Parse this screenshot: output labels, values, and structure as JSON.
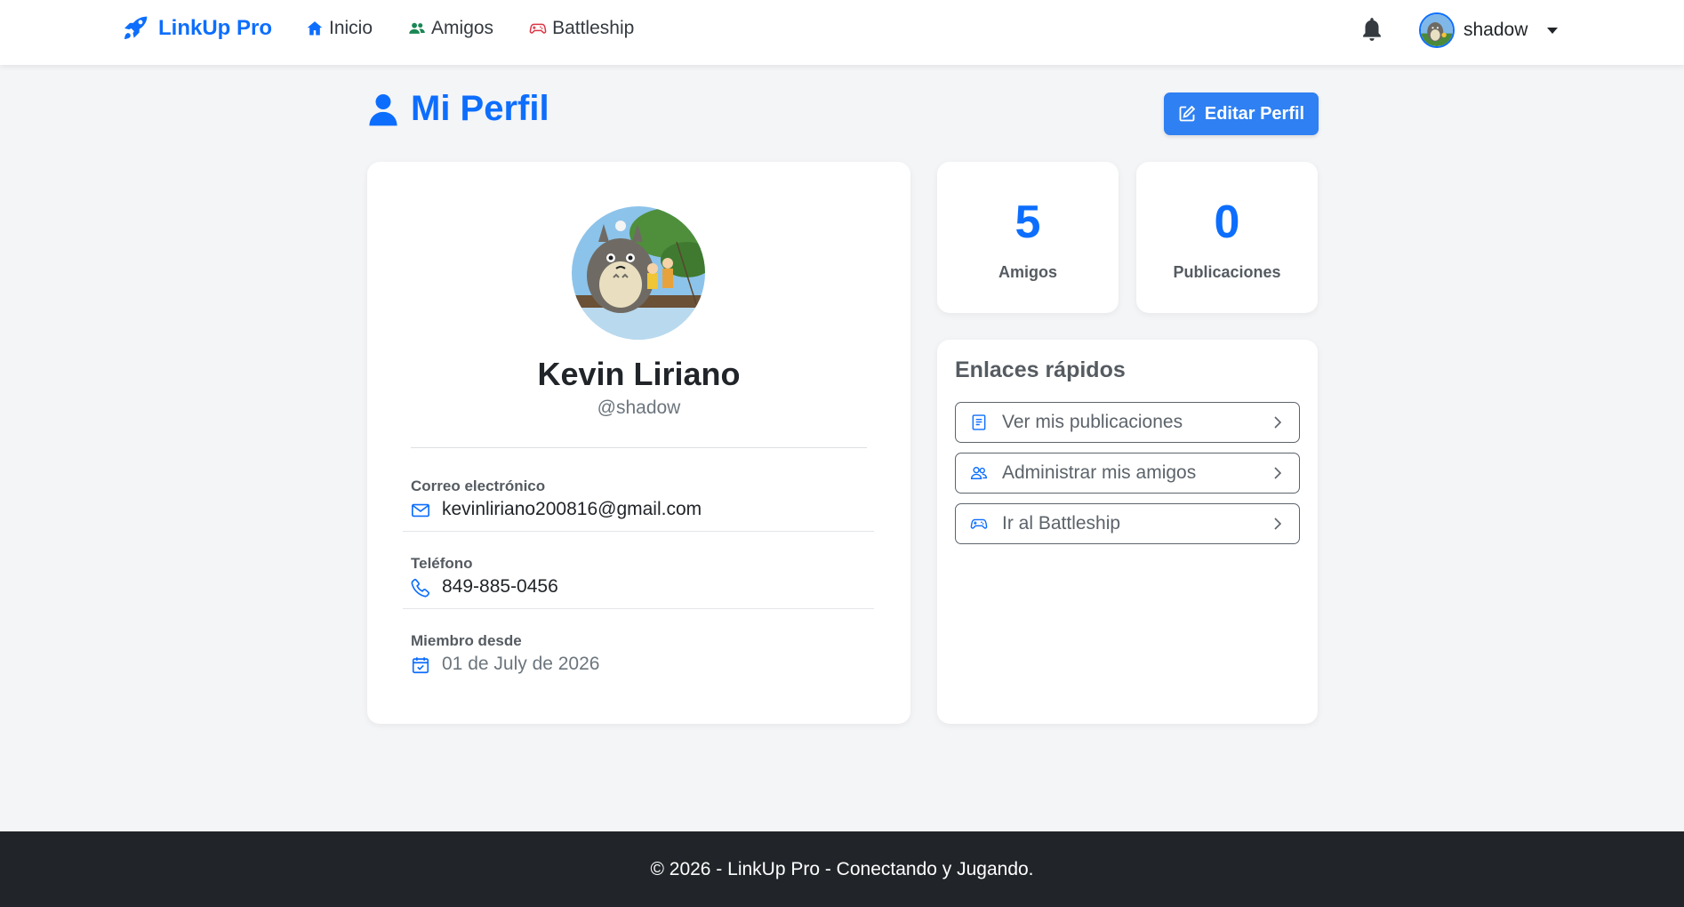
{
  "nav": {
    "brand": "LinkUp Pro",
    "links": [
      {
        "label": "Inicio",
        "icon": "home-icon",
        "color": "#0d6efd"
      },
      {
        "label": "Amigos",
        "icon": "users-icon",
        "color": "#198754"
      },
      {
        "label": "Battleship",
        "icon": "gamepad-icon",
        "color": "#dc3545"
      }
    ],
    "notifications_icon": "bell-icon",
    "user": {
      "username": "shadow"
    }
  },
  "page": {
    "title": "Mi Perfil",
    "edit_button": "Editar Perfil"
  },
  "profile": {
    "full_name": "Kevin Liriano",
    "handle": "@shadow",
    "email_label": "Correo electrónico",
    "email": "kevinliriano200816@gmail.com",
    "phone_label": "Teléfono",
    "phone": "849-885-0456",
    "member_label": "Miembro desde",
    "member_since": "01 de July de 2026"
  },
  "stats": [
    {
      "value": "5",
      "label": "Amigos"
    },
    {
      "value": "0",
      "label": "Publicaciones"
    }
  ],
  "quick_links": {
    "title": "Enlaces rápidos",
    "items": [
      {
        "label": "Ver mis publicaciones",
        "icon": "document-icon"
      },
      {
        "label": "Administrar mis amigos",
        "icon": "users-icon"
      },
      {
        "label": "Ir al Battleship",
        "icon": "gamepad-icon"
      }
    ]
  },
  "footer": {
    "text": "© 2026 - LinkUp Pro - Conectando y Jugando."
  },
  "colors": {
    "primary": "#0d6efd",
    "footer_bg": "#212529",
    "page_bg": "#f4f5f7"
  }
}
